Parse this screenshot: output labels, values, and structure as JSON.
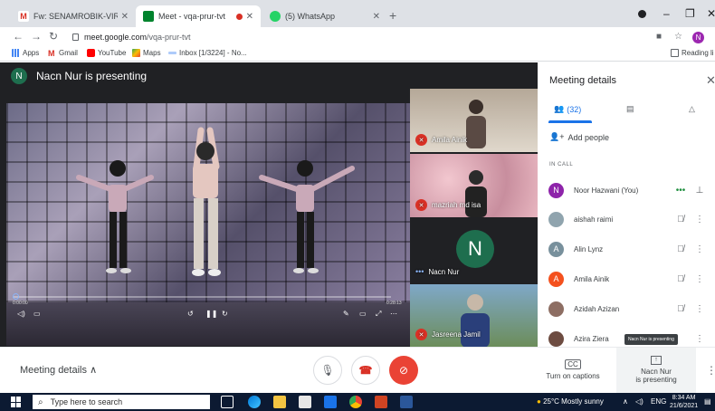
{
  "browser": {
    "tabs": [
      {
        "title": "Fw: SENAMROBIK-VIRTUAL FIT N",
        "favicon_color": "#d93025",
        "favicon": "gmail-icon"
      },
      {
        "title": "Meet - vqa-prur-tvt",
        "favicon_color": "#00832d",
        "favicon": "meet-icon",
        "active": true
      },
      {
        "title": "(5) WhatsApp",
        "favicon_color": "#25d366",
        "favicon": "whatsapp-icon"
      }
    ],
    "url_host": "meet.google.com",
    "url_path": "/vqa-prur-tvt",
    "profile_initial": "N",
    "bookmarks": [
      {
        "label": "Apps",
        "icon": "apps-grid-icon"
      },
      {
        "label": "Gmail",
        "icon": "gmail-icon"
      },
      {
        "label": "YouTube",
        "icon": "youtube-icon"
      },
      {
        "label": "Maps",
        "icon": "maps-icon"
      },
      {
        "label": "Inbox [1/3224] - No...",
        "icon": "inbox-icon"
      }
    ],
    "reading_list": "Reading li"
  },
  "meet": {
    "presenter_initial": "N",
    "presenter_text": "Nacn Nur is presenting",
    "video_time_left": "0:00:00",
    "video_time_right": "0:28:13",
    "tiles": [
      {
        "name": "Amila Ainik",
        "muted": true
      },
      {
        "name": "mazriah md isa",
        "muted": true
      },
      {
        "name": "Nacn Nur",
        "initial": "N",
        "muted": false
      },
      {
        "name": "Jasreena Jamil",
        "muted": true
      }
    ],
    "panel": {
      "title": "Meeting details",
      "people_count": "(32)",
      "add_people": "Add people",
      "in_call": "IN CALL",
      "participants": [
        {
          "name": "Noor Hazwani (You)",
          "initial": "N",
          "color": "#8e24aa",
          "state": "speaking"
        },
        {
          "name": "aishah raimi",
          "initial": "",
          "color": "#90a4ae",
          "state": "muted"
        },
        {
          "name": "Alin Lynz",
          "initial": "A",
          "color": "#78909c",
          "state": "muted"
        },
        {
          "name": "Amila Ainik",
          "initial": "A",
          "color": "#f4511e",
          "state": "muted"
        },
        {
          "name": "Azidah Azizan",
          "initial": "",
          "color": "#8d6e63",
          "state": "muted"
        },
        {
          "name": "Azira Ziera",
          "initial": "",
          "color": "#6d4c41",
          "state": "muted"
        }
      ],
      "tooltip": "Nacn Nur is presenting"
    },
    "bottom": {
      "meeting_details": "Meeting details",
      "captions": "Turn on captions",
      "captions_icon": "CC",
      "presenting_line1": "Nacn Nur",
      "presenting_line2": "is presenting"
    }
  },
  "taskbar": {
    "search_placeholder": "Type here to search",
    "weather": "25°C  Mostly sunny",
    "lang": "ENG",
    "time": "8:34 AM",
    "date": "21/6/2021"
  }
}
